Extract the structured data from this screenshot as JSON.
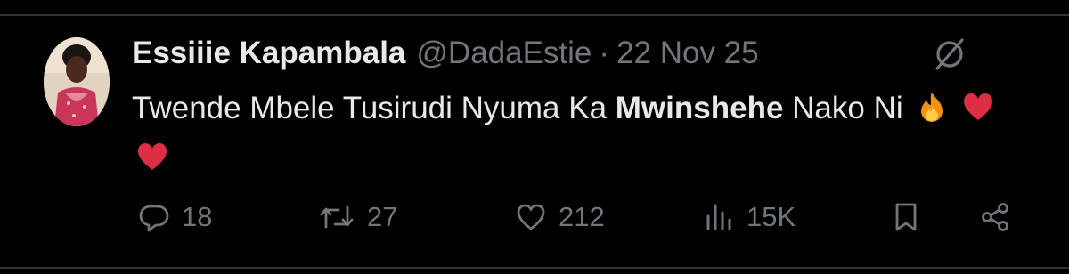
{
  "tweet": {
    "author_name": "Essiiie Kapambala",
    "handle": "@DadaEstie",
    "separator": "·",
    "date": "22 Nov 25",
    "text_before": "Twende Mbele Tusirudi Nyuma Ka",
    "text_bold": "Mwinshehe",
    "text_after": "Nako Ni",
    "emojis": [
      "fire-emoji",
      "red-heart-emoji",
      "red-heart-emoji"
    ]
  },
  "actions": {
    "replies": "18",
    "reposts": "27",
    "likes": "212",
    "views": "15K"
  },
  "icons": {
    "more": "grok-slash-icon",
    "reply": "reply-icon",
    "repost": "repost-icon",
    "like": "heart-icon",
    "views": "views-icon",
    "bookmark": "bookmark-icon",
    "share": "share-icon"
  },
  "colors": {
    "background": "#000000",
    "text_primary": "#e7e9ea",
    "text_secondary": "#71767b",
    "divider": "#2f3336"
  }
}
